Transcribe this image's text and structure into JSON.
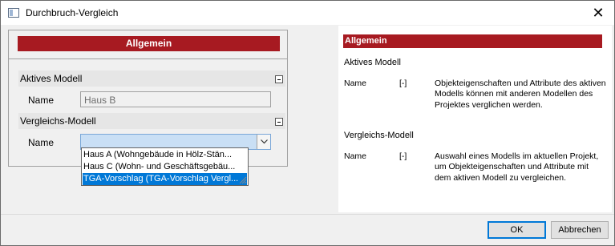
{
  "window": {
    "title": "Durchbruch-Vergleich",
    "icon": "window-icon",
    "close_glyph": "✕"
  },
  "left": {
    "header": "Allgemein",
    "groups": [
      {
        "title": "Aktives Modell",
        "field_label": "Name",
        "field_value": "Haus B"
      },
      {
        "title": "Vergleichs-Modell",
        "field_label": "Name",
        "field_value": ""
      }
    ],
    "dropdown": {
      "options": [
        "Haus A (Wohngebäude in Hölz-Stän...",
        "Haus C (Wohn- und Geschäftsgebäu...",
        "TGA-Vorschlag (TGA-Vorschlag Vergl..."
      ],
      "selected_index": 2
    }
  },
  "help": {
    "header": "Allgemein",
    "sections": [
      {
        "title": "Aktives Modell",
        "rows": [
          {
            "name": "Name",
            "flag": "[-]",
            "desc": "Objekteigenschaften und Attribute des aktiven Modells können mit anderen Modellen des Projektes verglichen werden."
          }
        ]
      },
      {
        "title": "Vergleichs-Modell",
        "rows": [
          {
            "name": "Name",
            "flag": "[-]",
            "desc": "Auswahl eines Modells im aktuellen Projekt, um Objekteigenschaften und Attribute mit dem aktiven Modell zu vergleichen."
          }
        ]
      }
    ]
  },
  "buttons": {
    "ok": "OK",
    "cancel": "Abbrechen"
  },
  "colors": {
    "accent_red": "#a71a21",
    "selection_blue": "#0078d7"
  }
}
